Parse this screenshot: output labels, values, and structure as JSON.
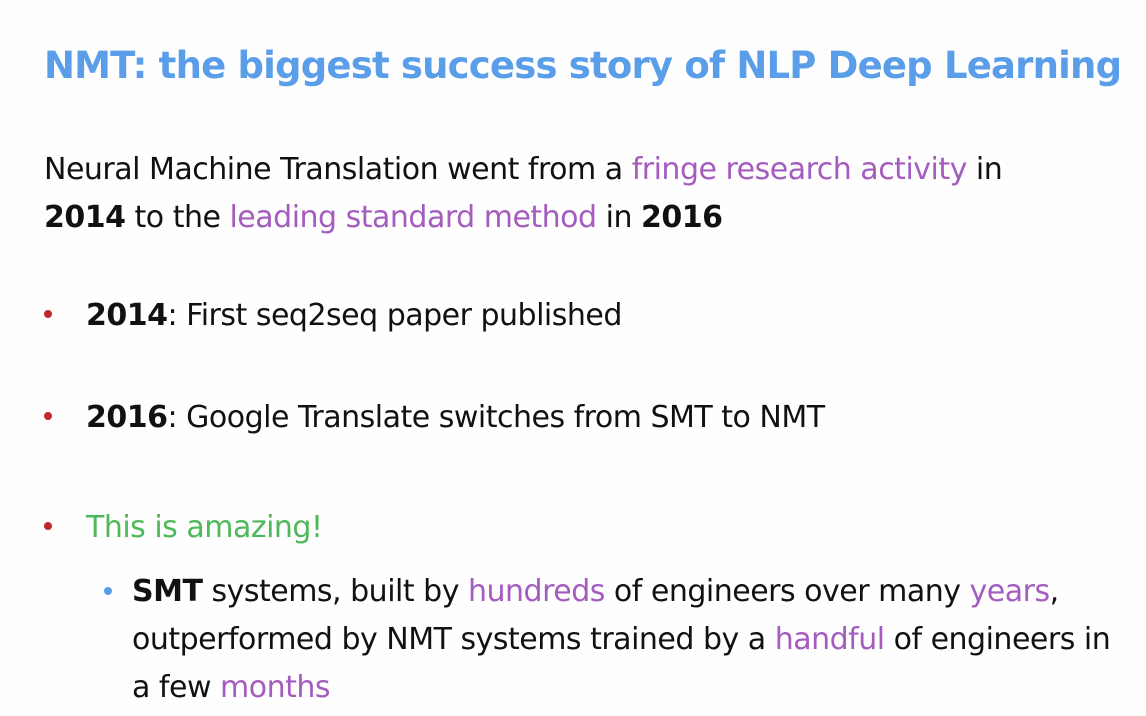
{
  "title": "NMT: the biggest success story of NLP Deep Learning",
  "colors": {
    "title": "#5a9de8",
    "highlight": "#a45cbf",
    "green": "#4fb85a",
    "bullet_red": "#c0282a",
    "bullet_blue": "#5a9de8"
  },
  "intro": {
    "part1": "Neural Machine Translation went from a ",
    "highlight1": "fringe research activity",
    "part2": " in ",
    "year1": "2014",
    "part3": " to the ",
    "highlight2": "leading standard method",
    "part4": " in ",
    "year2": "2016"
  },
  "bullets": [
    {
      "bold": "2014",
      "text": ": First seq2seq paper published"
    },
    {
      "bold": "2016",
      "text": ": Google Translate switches from SMT to NMT"
    },
    {
      "text": "This is amazing!"
    }
  ],
  "sub_bullet": {
    "bold": "SMT",
    "t1": " systems, built by ",
    "h1": "hundreds",
    "t2": " of engineers over many ",
    "h2": "years",
    "t3": ", outperformed by NMT systems trained by a ",
    "h3": "handful",
    "t4": " of engineers in a few ",
    "h4": "months"
  }
}
